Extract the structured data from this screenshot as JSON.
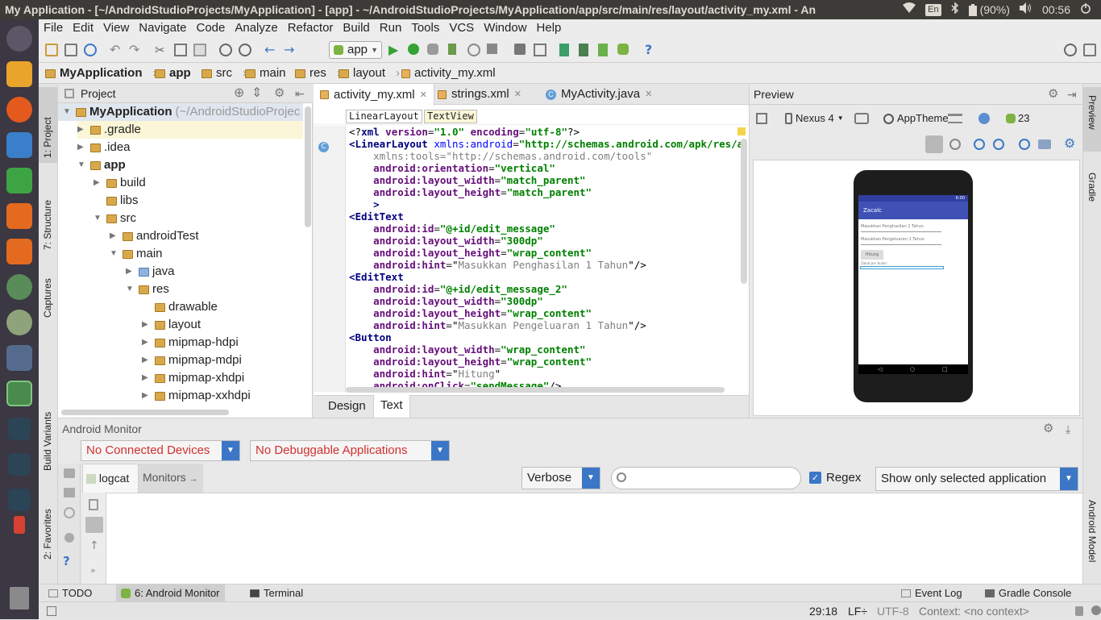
{
  "window_title": "My Application - [~/AndroidStudioProjects/MyApplication] - [app] - ~/AndroidStudioProjects/MyApplication/app/src/main/res/layout/activity_my.xml - An",
  "system": {
    "keyboard": "En",
    "battery": "(90%)",
    "clock": "00:56"
  },
  "menu": [
    "File",
    "Edit",
    "View",
    "Navigate",
    "Code",
    "Analyze",
    "Refactor",
    "Build",
    "Run",
    "Tools",
    "VCS",
    "Window",
    "Help"
  ],
  "toolbar": {
    "run_config": "app"
  },
  "breadcrumbs": [
    "MyApplication",
    "app",
    "src",
    "main",
    "res",
    "layout",
    "activity_my.xml"
  ],
  "left_tools": {
    "project": "1: Project",
    "structure": "7: Structure",
    "captures": "Captures",
    "build_variants": "Build Variants",
    "favorites": "2: Favorites"
  },
  "right_tools": {
    "preview": "Preview",
    "gradle": "Gradle",
    "android_model": "Android Model"
  },
  "project_panel": {
    "title": "Project",
    "root": "MyApplication",
    "root_path": "(~/AndroidStudioProjec",
    "items": [
      ".gradle",
      ".idea",
      "app",
      "build",
      "libs",
      "src",
      "androidTest",
      "main",
      "java",
      "res",
      "drawable",
      "layout",
      "mipmap-hdpi",
      "mipmap-mdpi",
      "mipmap-xhdpi",
      "mipmap-xxhdpi"
    ]
  },
  "editor": {
    "tabs": [
      "activity_my.xml",
      "strings.xml",
      "MyActivity.java"
    ],
    "crumbs": [
      "LinearLayout",
      "TextView"
    ],
    "bottom_tabs": [
      "Design",
      "Text"
    ],
    "code": [
      [
        "<?xml version=\"1.0\" encoding=\"utf-8\"?>"
      ],
      [
        "<LinearLayout xmlns:android=\"http://schemas.android.com/apk/res/android\""
      ],
      [
        "    xmlns:tools=\"http://schemas.android.com/tools\""
      ],
      [
        "    android:orientation=\"vertical\""
      ],
      [
        "    android:layout_width=\"match_parent\""
      ],
      [
        "    android:layout_height=\"match_parent\""
      ],
      [
        "    >"
      ],
      [
        "<EditText"
      ],
      [
        "    android:id=\"@+id/edit_message\""
      ],
      [
        "    android:layout_width=\"300dp\""
      ],
      [
        "    android:layout_height=\"wrap_content\""
      ],
      [
        "    android:hint=\"Masukkan Penghasilan 1 Tahun\"/>"
      ],
      [
        "<EditText"
      ],
      [
        "    android:id=\"@+id/edit_message_2\""
      ],
      [
        "    android:layout_width=\"300dp\""
      ],
      [
        "    android:layout_height=\"wrap_content\""
      ],
      [
        "    android:hint=\"Masukkan Pengeluaran 1 Tahun\"/>"
      ],
      [
        "<Button"
      ],
      [
        "    android:layout_width=\"wrap_content\""
      ],
      [
        "    android:layout_height=\"wrap_content\""
      ],
      [
        "    android:hint=\"Hitung\""
      ],
      [
        "    android:onClick=\"sendMessage\"/>"
      ]
    ]
  },
  "preview_panel": {
    "title": "Preview",
    "device": "Nexus 4",
    "theme": "AppTheme",
    "api": "23",
    "phone": {
      "time": "6:00",
      "app_title": "Zacalc",
      "hint1": "Masukkan Penghasilan 1 Tahun",
      "hint2": "Masukkan Pengeluaran 1 Tahun",
      "button": "Hitung",
      "result": "Zakat per bulan:"
    }
  },
  "monitor": {
    "title": "Android Monitor",
    "devices": "No Connected Devices",
    "apps": "No Debuggable Applications",
    "tab_logcat": "logcat",
    "tab_monitors": "Monitors",
    "log_level": "Verbose",
    "regex": "Regex",
    "filter": "Show only selected application"
  },
  "bottom_tools": {
    "todo": "TODO",
    "monitor": "6: Android Monitor",
    "terminal": "Terminal",
    "event_log": "Event Log",
    "gradle_console": "Gradle Console"
  },
  "status": {
    "position": "29:18",
    "line_sep": "LF÷",
    "encoding": "UTF-8",
    "context": "Context: <no context>"
  }
}
